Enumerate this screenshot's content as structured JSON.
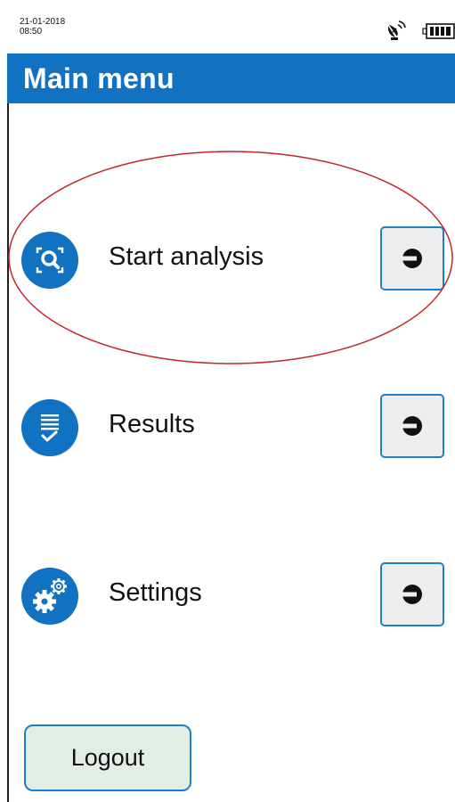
{
  "status_bar": {
    "date": "21-01-2018",
    "time": "08:50",
    "signal_icon": "satellite-dish-icon",
    "battery_icon": "battery-full-icon"
  },
  "header": {
    "title": "Main menu",
    "color": "#1272c2"
  },
  "menu": {
    "items": [
      {
        "label": "Start analysis",
        "icon": "analysis-search-icon",
        "action_icon": "arrow-right-icon",
        "highlighted": true
      },
      {
        "label": "Results",
        "icon": "results-list-check-icon",
        "action_icon": "arrow-right-icon"
      },
      {
        "label": "Settings",
        "icon": "settings-gears-icon",
        "action_icon": "arrow-right-icon"
      }
    ]
  },
  "footer": {
    "logout_label": "Logout"
  },
  "colors": {
    "accent": "#1272c2",
    "button_border": "#1d7fcc",
    "highlight": "#c1272d"
  }
}
